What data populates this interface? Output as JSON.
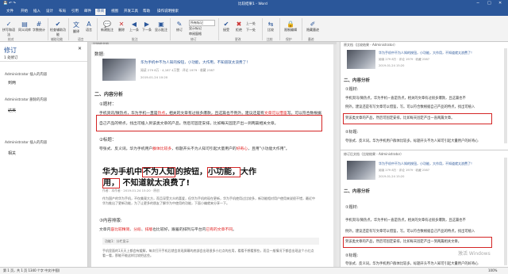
{
  "window": {
    "title": "比较结果1 - Word",
    "controls": [
      "−",
      "□",
      "✕"
    ]
  },
  "tabs": [
    "文件",
    "开始",
    "插入",
    "设计",
    "布局",
    "引用",
    "邮件",
    "审阅",
    "视图",
    "开发工具",
    "帮助",
    "操作说明搜索"
  ],
  "active_tab": "审阅",
  "ribbon": {
    "buttons": [
      "拼写和语法",
      "同义词库",
      "字数统计",
      "检查辅助功能",
      "翻译",
      "语言",
      "新建批注",
      "删除",
      "上一条",
      "下一条",
      "显示批注",
      "修订",
      "所有标记",
      "显示标记",
      "审阅窗格",
      "接受",
      "拒绝",
      "上一处",
      "下一处",
      "比较",
      "限制编辑",
      "隐藏墨迹"
    ],
    "groups": [
      "校对",
      "辅助功能",
      "语言",
      "批注",
      "修订",
      "更改",
      "比较",
      "保护",
      "墨迹"
    ]
  },
  "left_pane": {
    "title": "修订",
    "subtitle": "1 处修订",
    "items": [
      {
        "author": "Administrator 插入的内容",
        "value": "到两"
      },
      {
        "author": "Administrator 删除的内容",
        "value": "达美"
      },
      {
        "author": "Administrator 插入的内容",
        "value": "相关"
      }
    ]
  },
  "doc": {
    "header": "比较的文档",
    "data_label": "数据:",
    "card_title": "华为手机中不为人知的按钮，小功能，大作用，不知道就太浪费了！",
    "card_meta1": "阅读 279 8万 · 4,167 4万赞 · 评论 1979 · 收藏 2387",
    "card_date": "2019-01-24 10:20",
    "section2": "二、内容分析",
    "q1": "①题材：",
    "para1_a": "手机资讯/微热点，华为手机一直是",
    "para1_hot": "热点",
    "para1_b": "，相关的文章有过很多爆款，且这篇也不例外。建议还是有",
    "para1_c": "文章可以",
    "para1_d": "借鉴",
    "para1_e": "写。可以符合数根据",
    "para1_f": "自己产品的特点，找出可植入到该类文章的产品，然后可固定安排，比如每天固定产出一到两篇相关文章。",
    "q2": "②标题：",
    "para2_a": "夸张式、反义词。华为手机用户",
    "para2_b": "群体比较多",
    "para2_c": "，标题开头不为人知可引起大量用户的",
    "para2_d": "好奇心",
    "para2_e": "，且用\"小功能大作用\"。",
    "headline_a": "华为手机中",
    "headline_b": "不为人知",
    "headline_c": "的按钮，",
    "headline_d": "小功能，",
    "headline_e": "大作",
    "headline_f": "用，",
    "headline_g": "不知道就太浪费了!",
    "art_meta": "作者：本作者 · 2019-01-24 15:20 · 原创",
    "art_body": "作为国产的华为手机，不仅美观大方，而且深受大众的喜爱，但华为手机的现在更新，华为手机使用过比较多，新功能相对用户使用来说很不错，最近中华为推出了更新功能，为了让更多的朋友了解华为中使用的功能，下面小编就来分享一下。",
    "q3": "③内容排版:",
    "para3_a": "文章内",
    "para3_b": "容比较精简",
    "para3_c": "、",
    "para3_d": "分段",
    "para3_e": "、",
    "para3_f": "排版",
    "para3_g": "也比较好，跟着的排列与平台内",
    "para3_h": "已有的文章不同",
    "para3_i": "。",
    "tip_label": "功能1：分栏显示",
    "tail": "手机里面的1天天上都会有缓解，每次打开手机后就会发现屏幕的底部会出现很多小红点的应用，看看不想看那些，而且一般情况下都会出现这个小红点看一看，那能不能这样比较把这些。"
  },
  "right_pane": {
    "header1": "原文档（比较结果 - Administrator）",
    "header2": "修订后文档（比较结果 - Administrator）",
    "r_title": "华为手机中不为人知的按钮，小功能，大作用，不知道就太浪费了！",
    "r_meta": "阅读 279 8万 · 评论 1979 · 收藏 2387",
    "r_date": "2019-01-24 15:20",
    "r_section": "二、内容分析",
    "r_q1": "①题材:",
    "r_p1": "手机资讯/微热点，华为手机一直是热点，相关的文章有过很多爆款，且这篇也不",
    "r_p2": "例外。建议还是有写文章可以借鉴，写。可以符合数根据自己产品的特点，找出可植入",
    "r_p3": "到该类文章的产品，然后可固定安排，比如每天固定产出一直两篇文章。",
    "r_q2": "②标题:",
    "r_p4": "夸张式、反义词。华为手机用户群体比较多，标题开头不为人知可引起大量用户的好奇心",
    "r_p5": "到该类文章的产品，然后可固定安排，比如每天固定产出一到两篇相关文章。",
    "watermark": "激活 Windows"
  },
  "status": {
    "left": "第 1 页，共 1 页    1340 个字    中文(中国)",
    "zoom": "100%"
  },
  "colors": {
    "brand": "#2b579a",
    "red": "#e02020",
    "highlight": "#fff36a"
  }
}
